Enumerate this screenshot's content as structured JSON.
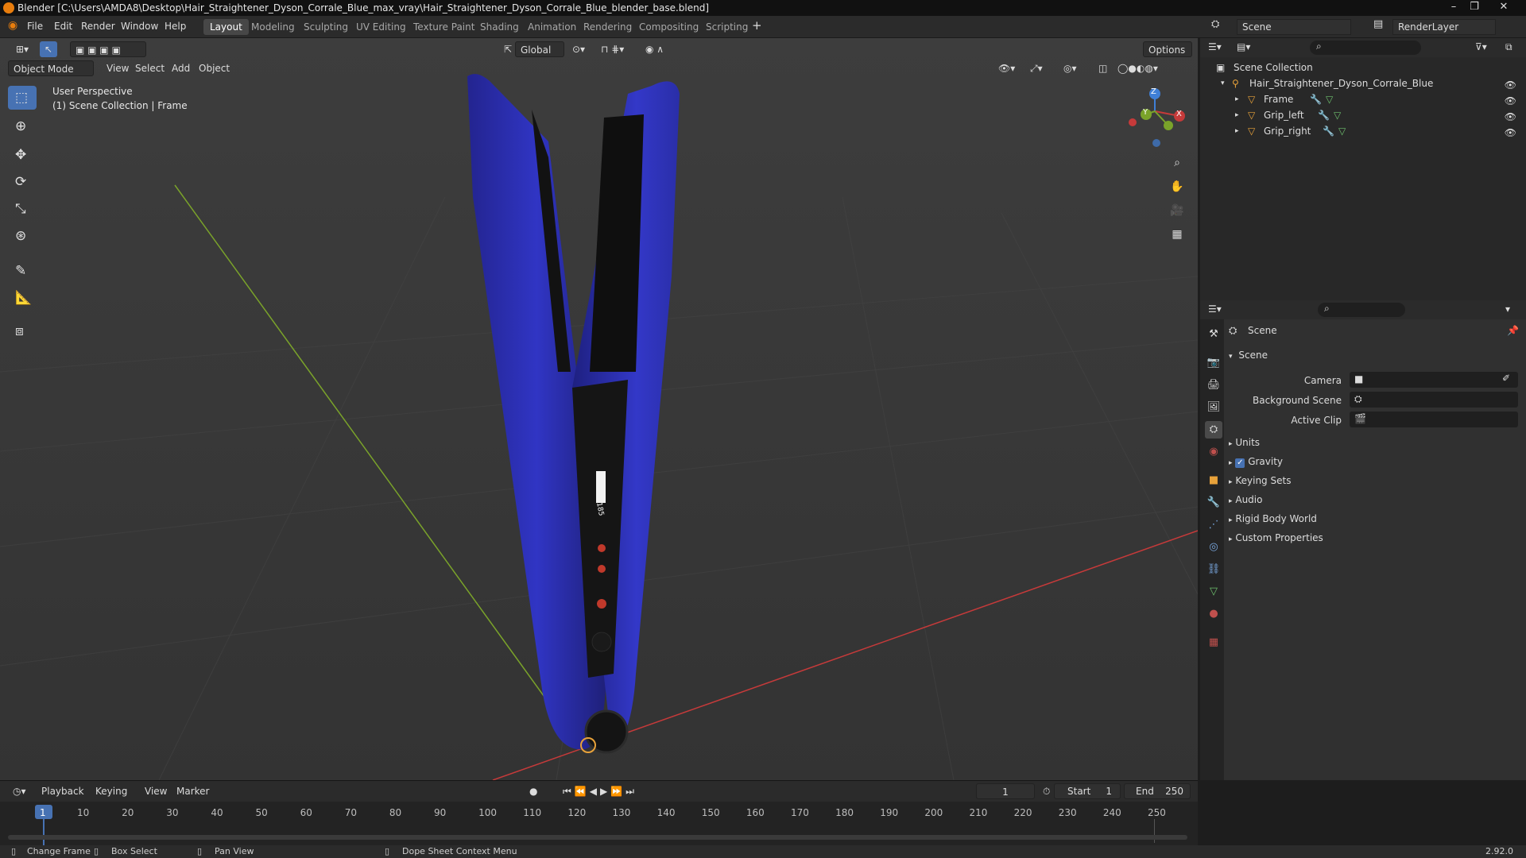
{
  "window": {
    "title": "Blender [C:\\Users\\AMDA8\\Desktop\\Hair_Straightener_Dyson_Corrale_Blue_max_vray\\Hair_Straightener_Dyson_Corrale_Blue_blender_base.blend]"
  },
  "menu": [
    "File",
    "Edit",
    "Render",
    "Window",
    "Help"
  ],
  "workspaces": [
    "Layout",
    "Modeling",
    "Sculpting",
    "UV Editing",
    "Texture Paint",
    "Shading",
    "Animation",
    "Rendering",
    "Compositing",
    "Scripting"
  ],
  "active_workspace": "Layout",
  "scene_selector": {
    "scene": "Scene",
    "render_layer": "RenderLayer"
  },
  "viewport": {
    "header": {
      "transform": "Global",
      "options": "Options",
      "mode": "Object Mode",
      "menus": [
        "View",
        "Select",
        "Add",
        "Object"
      ]
    },
    "overlay_text": {
      "line1": "User Perspective",
      "line2": "(1) Scene Collection | Frame"
    },
    "gizmo_axes": {
      "x": "X",
      "y": "Y",
      "z": "Z"
    },
    "device_display": "185"
  },
  "outliner": {
    "root": "Scene Collection",
    "collection": "Hair_Straightener_Dyson_Corrale_Blue",
    "objects": [
      "Frame",
      "Grip_left",
      "Grip_right"
    ]
  },
  "properties": {
    "context": "Scene",
    "panel": "Scene",
    "fields": {
      "camera": "Camera",
      "background_scene": "Background Scene",
      "active_clip": "Active Clip"
    },
    "sections": [
      "Units",
      "Gravity",
      "Keying Sets",
      "Audio",
      "Rigid Body World",
      "Custom Properties"
    ],
    "gravity_checked": true
  },
  "timeline": {
    "menus": [
      "Playback",
      "Keying",
      "View",
      "Marker"
    ],
    "current_frame": "1",
    "start_label": "Start",
    "start": "1",
    "end_label": "End",
    "end": "250",
    "ticks": [
      "1",
      "10",
      "20",
      "30",
      "40",
      "50",
      "60",
      "70",
      "80",
      "90",
      "100",
      "110",
      "120",
      "130",
      "140",
      "150",
      "160",
      "170",
      "180",
      "190",
      "200",
      "210",
      "220",
      "230",
      "240",
      "250"
    ]
  },
  "statusbar": {
    "items": [
      "Change Frame",
      "Box Select",
      "Pan View",
      "Dope Sheet Context Menu"
    ],
    "version": "2.92.0"
  },
  "colors": {
    "accent": "#4772b3",
    "device_blue": "#2c2fb0",
    "x_axis": "#c63a3a",
    "y_axis": "#7aa32a",
    "z_axis": "#3f7fd6"
  }
}
